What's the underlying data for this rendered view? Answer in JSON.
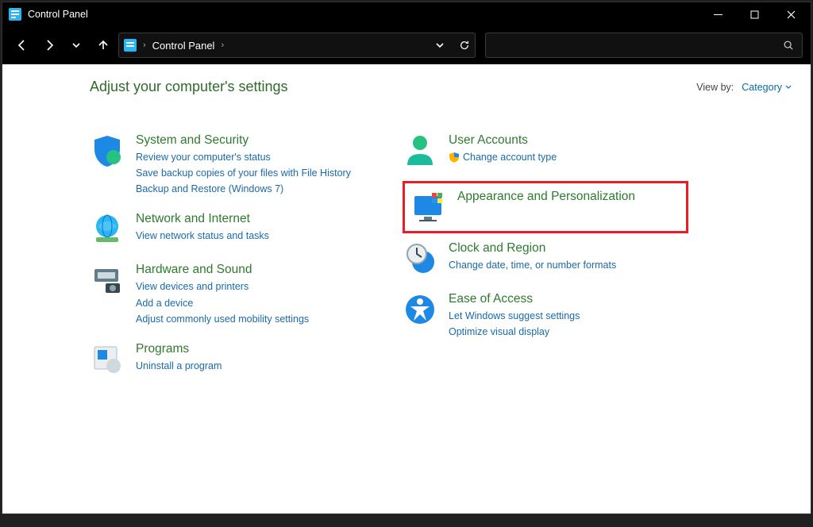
{
  "window": {
    "title": "Control Panel"
  },
  "address": {
    "location": "Control Panel"
  },
  "header": {
    "title": "Adjust your computer's settings",
    "viewby_label": "View by:",
    "viewby_value": "Category"
  },
  "left": [
    {
      "title": "System and Security",
      "links": [
        "Review your computer's status",
        "Save backup copies of your files with File History",
        "Backup and Restore (Windows 7)"
      ]
    },
    {
      "title": "Network and Internet",
      "links": [
        "View network status and tasks"
      ]
    },
    {
      "title": "Hardware and Sound",
      "links": [
        "View devices and printers",
        "Add a device",
        "Adjust commonly used mobility settings"
      ]
    },
    {
      "title": "Programs",
      "links": [
        "Uninstall a program"
      ]
    }
  ],
  "right": [
    {
      "title": "User Accounts",
      "links": [
        "Change account type"
      ]
    },
    {
      "title": "Appearance and Personalization",
      "links": []
    },
    {
      "title": "Clock and Region",
      "links": [
        "Change date, time, or number formats"
      ]
    },
    {
      "title": "Ease of Access",
      "links": [
        "Let Windows suggest settings",
        "Optimize visual display"
      ]
    }
  ]
}
